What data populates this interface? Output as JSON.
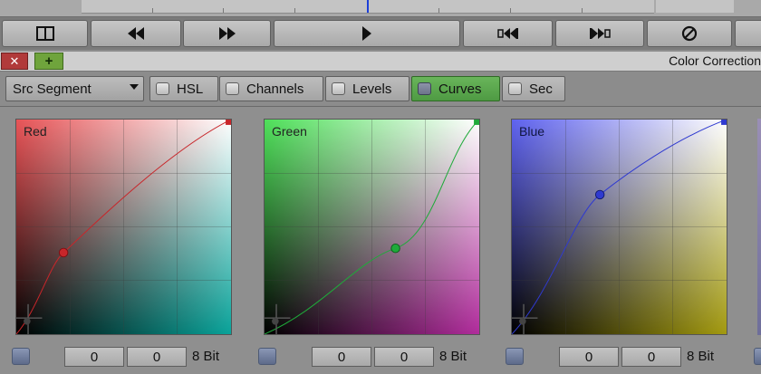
{
  "tab_title": "Color Correction",
  "source_select": {
    "value": "Src Segment"
  },
  "modes": [
    {
      "label": "HSL",
      "active": false
    },
    {
      "label": "Channels",
      "active": false
    },
    {
      "label": "Levels",
      "active": false
    },
    {
      "label": "Curves",
      "active": true
    },
    {
      "label": "Sec",
      "active": false
    }
  ],
  "transport_icons": [
    "split-view-icon",
    "rewind-icon",
    "fast-forward-icon",
    "play-icon",
    "step-back-icon",
    "step-forward-icon",
    "disable-icon"
  ],
  "curves": [
    {
      "label": "Red",
      "channel": "red",
      "point": [
        0.22,
        0.38
      ],
      "input": "0",
      "output": "0",
      "bit_depth": "8 Bit",
      "color": "#c8262a"
    },
    {
      "label": "Green",
      "channel": "green",
      "point": [
        0.61,
        0.4
      ],
      "input": "0",
      "output": "0",
      "bit_depth": "8 Bit",
      "color": "#1faa3a"
    },
    {
      "label": "Blue",
      "channel": "blue",
      "point": [
        0.41,
        0.65
      ],
      "input": "0",
      "output": "0",
      "bit_depth": "8 Bit",
      "color": "#2f3ad0"
    }
  ]
}
